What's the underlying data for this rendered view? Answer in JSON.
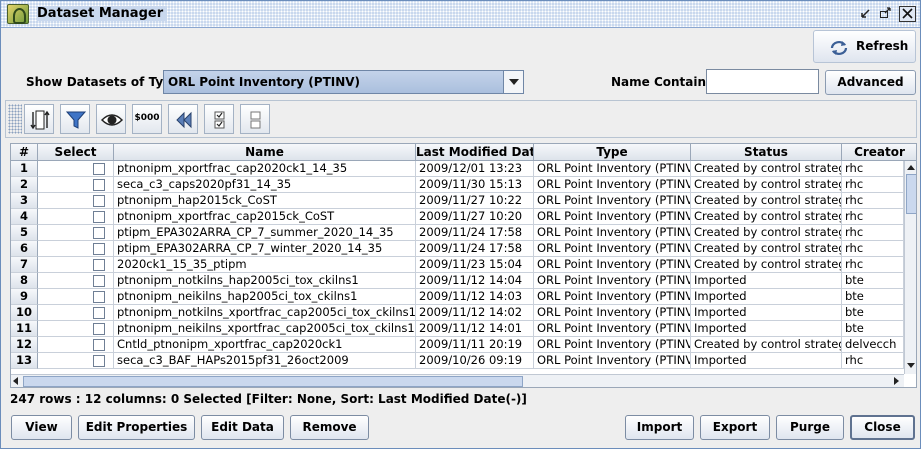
{
  "window": {
    "title": "Dataset Manager"
  },
  "topbar": {
    "refresh_label": "Refresh"
  },
  "filters": {
    "type_label": "Show Datasets of Type:",
    "type_value": "ORL Point Inventory (PTINV)",
    "name_label": "Name Contains:",
    "name_value": "",
    "advanced_label": "Advanced"
  },
  "toolbar": {
    "format_label": "$000"
  },
  "table": {
    "columns": [
      "#",
      "Select",
      "Name",
      "Last Modified Date",
      "Type",
      "Status",
      "Creator"
    ],
    "rows": [
      [
        "1",
        "ptnonipm_xportfrac_cap2020ck1_14_35",
        "2009/12/01 13:23",
        "ORL Point Inventory (PTINV)",
        "Created by control strategy",
        "rhc"
      ],
      [
        "2",
        "seca_c3_caps2020pf31_14_35",
        "2009/11/30 15:13",
        "ORL Point Inventory (PTINV)",
        "Created by control strategy",
        "rhc"
      ],
      [
        "3",
        "ptnonipm_hap2015ck_CoST",
        "2009/11/27 10:22",
        "ORL Point Inventory (PTINV)",
        "Created by control strategy",
        "rhc"
      ],
      [
        "4",
        "ptnonipm_xportfrac_cap2015ck_CoST",
        "2009/11/27 10:20",
        "ORL Point Inventory (PTINV)",
        "Created by control strategy",
        "rhc"
      ],
      [
        "5",
        "ptipm_EPA302ARRA_CP_7_summer_2020_14_35",
        "2009/11/24 17:58",
        "ORL Point Inventory (PTINV)",
        "Created by control strategy",
        "rhc"
      ],
      [
        "6",
        "ptipm_EPA302ARRA_CP_7_winter_2020_14_35",
        "2009/11/24 17:58",
        "ORL Point Inventory (PTINV)",
        "Created by control strategy",
        "rhc"
      ],
      [
        "7",
        "2020ck1_15_35_ptipm",
        "2009/11/23 15:04",
        "ORL Point Inventory (PTINV)",
        "Created by control strategy",
        "rhc"
      ],
      [
        "8",
        "ptnonipm_notkilns_hap2005ci_tox_ckilns1",
        "2009/11/12 14:04",
        "ORL Point Inventory (PTINV)",
        "Imported",
        "bte"
      ],
      [
        "9",
        "ptnonipm_neikilns_hap2005ci_tox_ckilns1",
        "2009/11/12 14:03",
        "ORL Point Inventory (PTINV)",
        "Imported",
        "bte"
      ],
      [
        "10",
        "ptnonipm_notkilns_xportfrac_cap2005ci_tox_ckilns1",
        "2009/11/12 14:02",
        "ORL Point Inventory (PTINV)",
        "Imported",
        "bte"
      ],
      [
        "11",
        "ptnonipm_neikilns_xportfrac_cap2005ci_tox_ckilns1",
        "2009/11/12 14:01",
        "ORL Point Inventory (PTINV)",
        "Imported",
        "bte"
      ],
      [
        "12",
        "Cntld_ptnonipm_xportfrac_cap2020ck1",
        "2009/11/11 20:19",
        "ORL Point Inventory (PTINV)",
        "Created by control strategy",
        "delvecch"
      ],
      [
        "13",
        "seca_c3_BAF_HAPs2015pf31_26oct2009",
        "2009/10/26 09:19",
        "ORL Point Inventory (PTINV)",
        "Imported",
        "rhc"
      ]
    ]
  },
  "status_text": "247 rows : 12 columns: 0 Selected [Filter: None, Sort: Last Modified Date(-)]",
  "buttons": {
    "view": "View",
    "edit_properties": "Edit Properties",
    "edit_data": "Edit Data",
    "remove": "Remove",
    "import": "Import",
    "export": "Export",
    "purge": "Purge",
    "close": "Close"
  }
}
